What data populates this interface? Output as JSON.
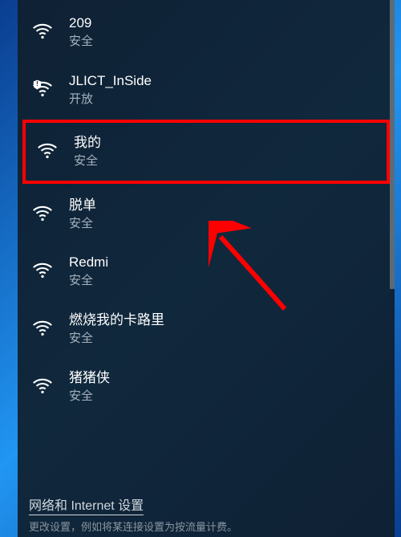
{
  "networks": [
    {
      "name": "209",
      "status": "安全",
      "icon": "wifi",
      "highlighted": false
    },
    {
      "name": "JLICT_InSide",
      "status": "开放",
      "icon": "wifi-open",
      "highlighted": false
    },
    {
      "name": "我的",
      "status": "安全",
      "icon": "wifi",
      "highlighted": true
    },
    {
      "name": "脱单",
      "status": "安全",
      "icon": "wifi",
      "highlighted": false
    },
    {
      "name": "Redmi",
      "status": "安全",
      "icon": "wifi",
      "highlighted": false
    },
    {
      "name": "燃烧我的卡路里",
      "status": "安全",
      "icon": "wifi",
      "highlighted": false
    },
    {
      "name": "猪猪侠",
      "status": "安全",
      "icon": "wifi",
      "highlighted": false
    }
  ],
  "footer": {
    "link": "网络和 Internet 设置",
    "sub": "更改设置，例如将某连接设置为按流量计费。"
  },
  "annotation": {
    "highlight_color": "#ff0000",
    "arrow_color": "#ff0000"
  }
}
